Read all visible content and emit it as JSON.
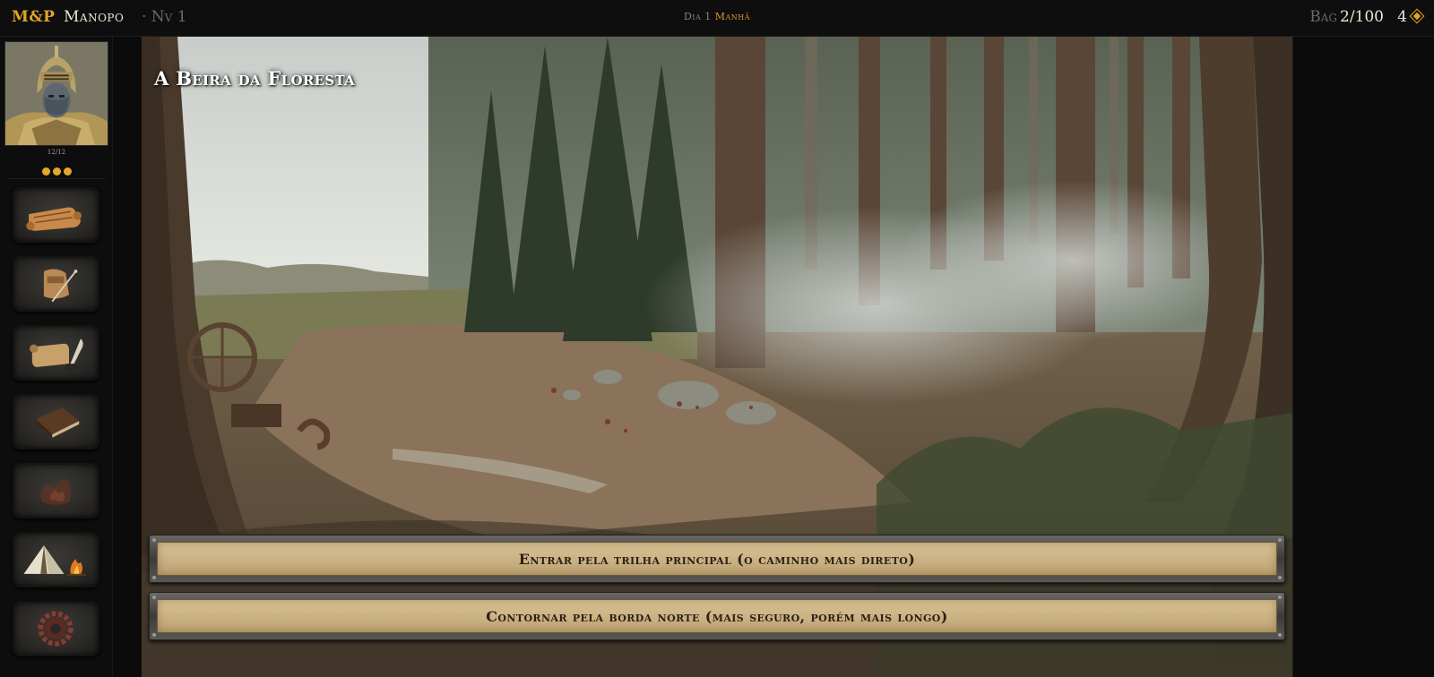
{
  "topbar": {
    "logo": "M&P",
    "player_name": "Manopo",
    "player_level": "· Nv 1",
    "day": "Dia 1",
    "period": "Manhã",
    "bag_label": "Bag",
    "bag_count": "2/100",
    "gold": "4",
    "gold_icon": "diamond-coin-icon"
  },
  "character": {
    "hp": "12/12",
    "action_points": 3,
    "portrait_icon": "armored-knight-portrait"
  },
  "sidebar_menu": [
    {
      "name": "map-scroll-icon"
    },
    {
      "name": "inventory-bag-icon"
    },
    {
      "name": "quest-scroll-quill-icon"
    },
    {
      "name": "journal-book-icon"
    },
    {
      "name": "skills-flame-icon"
    },
    {
      "name": "camp-tent-icon"
    },
    {
      "name": "settings-gear-icon"
    }
  ],
  "scene": {
    "title": "A Beira da Floresta",
    "choices": [
      {
        "label": "Entrar pela trilha principal (o caminho mais direto)"
      },
      {
        "label": "Contornar pela borda norte (mais seguro, porém mais longo)"
      }
    ]
  },
  "colors": {
    "accent_gold": "#e0a526",
    "period_orange": "#d79a2a",
    "choice_parchment": "#ccb385",
    "choice_text": "#2b2114"
  }
}
